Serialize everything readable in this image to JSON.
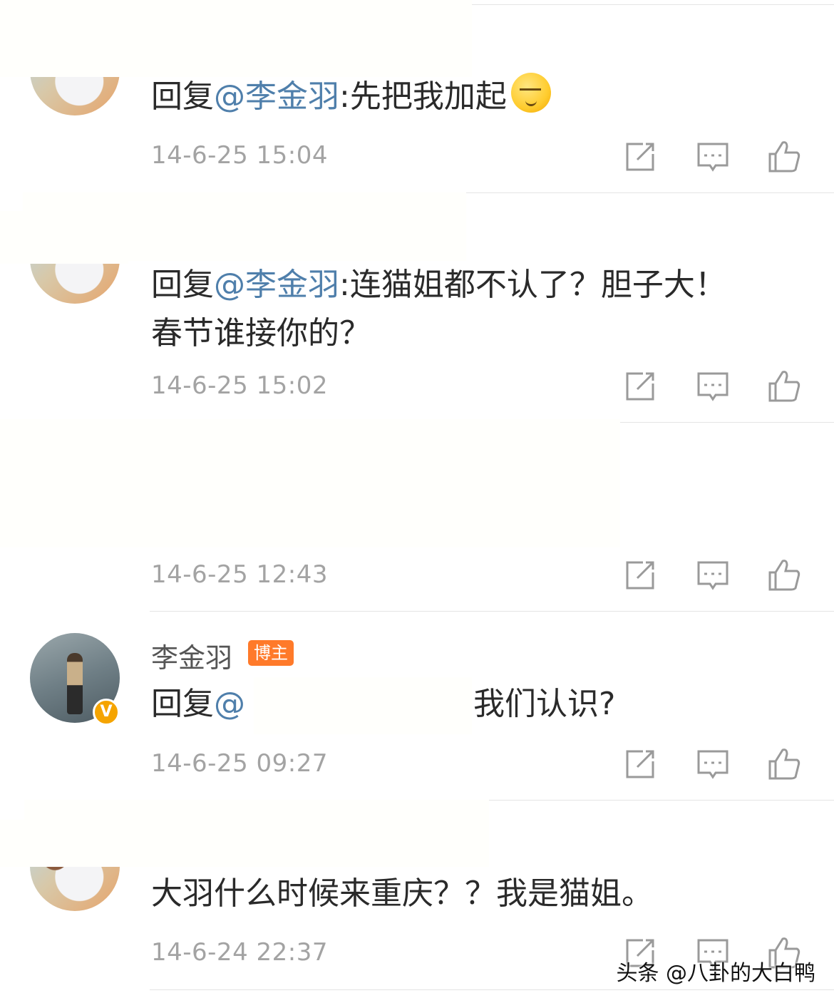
{
  "comments": [
    {
      "reply_prefix": "回复",
      "mention": "@李金羽",
      "body": ":先把我加起",
      "emoji": "smirk-emoji",
      "timestamp": "14-6-25 15:04"
    },
    {
      "reply_prefix": "回复",
      "mention": "@李金羽",
      "body_line1": ":连猫姐都不认了？胆子大！",
      "body_line2": "春节谁接你的？",
      "timestamp": "14-6-25 15:02"
    },
    {
      "timestamp": "14-6-25 12:43"
    },
    {
      "username": "李金羽",
      "role_badge": "博主",
      "verified_badge": "V",
      "reply_prefix": "回复",
      "mention": "@",
      "body": "我们认识?",
      "timestamp": "14-6-25 09:27"
    },
    {
      "body": "大羽什么时候来重庆？？我是猫姐。",
      "timestamp": "14-6-24 22:37"
    }
  ],
  "icons": {
    "repost": "repost-icon",
    "comment": "comment-icon",
    "like": "like-icon"
  },
  "colors": {
    "mention": "#4f7fab",
    "role_badge": "#ff7a2a",
    "verified_badge": "#f5a400",
    "timestamp": "#a3a3a3"
  },
  "watermark": "头条 @八卦的大白鸭"
}
